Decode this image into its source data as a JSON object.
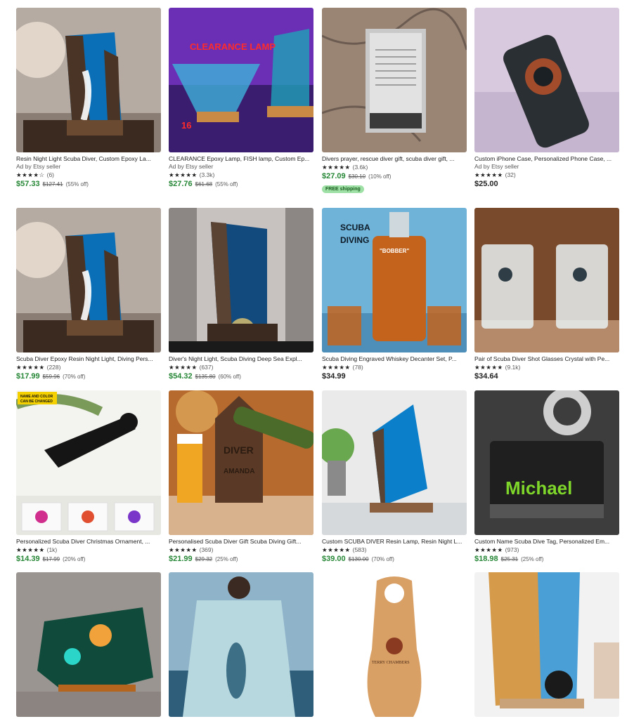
{
  "colors": {
    "sale_price": "#258635",
    "free_shipping_bg": "#9ee0a5",
    "text": "#222222",
    "muted": "#595959"
  },
  "products": [
    {
      "title": "Resin Night Light Scuba Diver, Custom Epoxy La...",
      "ad": "Ad by Etsy seller",
      "stars": "★★★★☆",
      "rating": 4,
      "reviews": "(6)",
      "price": "$57.33",
      "original": "$127.41",
      "discount": "(55% off)",
      "sale": true,
      "thumb": "resin-lamp-icon"
    },
    {
      "title": "CLEARANCE Epoxy Lamp, FISH lamp, Custom Ep...",
      "ad": "Ad by Etsy seller",
      "stars": "★★★★★",
      "rating": 5,
      "reviews": "(3.3k)",
      "price": "$27.76",
      "original": "$61.68",
      "discount": "(55% off)",
      "sale": true,
      "thumb": "clearance-lamp-icon",
      "overlay": "CLEARANCE LAMP",
      "overlay_num": "16"
    },
    {
      "title": "Divers prayer, rescue diver gift, scuba diver gift, ...",
      "ad": "",
      "stars": "★★★★★",
      "rating": 5,
      "reviews": "(3.6k)",
      "price": "$27.09",
      "original": "$30.10",
      "discount": "(10% off)",
      "sale": true,
      "badge": "FREE shipping",
      "thumb": "prayer-plaque-icon"
    },
    {
      "title": "Custom iPhone Case, Personalized Phone Case, ...",
      "ad": "Ad by Etsy seller",
      "stars": "★★★★★",
      "rating": 5,
      "reviews": "(32)",
      "price": "$25.00",
      "original": "",
      "discount": "",
      "sale": false,
      "thumb": "phone-case-icon"
    },
    {
      "title": "Scuba Diver Epoxy Resin Night Light, Diving Pers...",
      "ad": "",
      "stars": "★★★★★",
      "rating": 4.5,
      "reviews": "(228)",
      "price": "$17.99",
      "original": "$59.96",
      "discount": "(70% off)",
      "sale": true,
      "thumb": "resin-lamp-icon"
    },
    {
      "title": "Diver's Night Light, Scuba Diving Deep Sea Expl...",
      "ad": "",
      "stars": "★★★★★",
      "rating": 5,
      "reviews": "(637)",
      "price": "$54.32",
      "original": "$135.80",
      "discount": "(60% off)",
      "sale": true,
      "thumb": "night-light-icon"
    },
    {
      "title": "Scuba Diving Engraved Whiskey Decanter Set, P...",
      "ad": "",
      "stars": "★★★★★",
      "rating": 5,
      "reviews": "(78)",
      "price": "$34.99",
      "original": "",
      "discount": "",
      "sale": false,
      "thumb": "decanter-icon",
      "overlay": "SCUBA DIVING",
      "overlay_num": "\"BOBBER\""
    },
    {
      "title": "Pair of Scuba Diver Shot Glasses Crystal with Pe...",
      "ad": "",
      "stars": "★★★★★",
      "rating": 4.5,
      "reviews": "(9.1k)",
      "price": "$34.64",
      "original": "",
      "discount": "",
      "sale": false,
      "thumb": "shot-glasses-icon"
    },
    {
      "title": "Personalized Scuba Diver Christmas Ornament, ...",
      "ad": "",
      "stars": "★★★★★",
      "rating": 4.5,
      "reviews": "(1k)",
      "price": "$14.39",
      "original": "$17.99",
      "discount": "(20% off)",
      "sale": true,
      "thumb": "ornament-icon",
      "overlay": "NAME AND COLOR CAN BE CHANGED"
    },
    {
      "title": "Personalised Scuba Diver Gift Scuba Diving Gift...",
      "ad": "",
      "stars": "★★★★★",
      "rating": 5,
      "reviews": "(369)",
      "price": "$21.99",
      "original": "$29.32",
      "discount": "(25% off)",
      "sale": true,
      "thumb": "bottle-opener-icon",
      "overlay": "DIVER",
      "overlay_num": "AMANDA"
    },
    {
      "title": "Custom SCUBA DIVER Resin Lamp, Resin Night L...",
      "ad": "",
      "stars": "★★★★★",
      "rating": 5,
      "reviews": "(583)",
      "price": "$39.00",
      "original": "$130.00",
      "discount": "(70% off)",
      "sale": true,
      "thumb": "resin-lamp-blue-icon"
    },
    {
      "title": "Custom Name Scuba Dive Tag, Personalized Em...",
      "ad": "",
      "stars": "★★★★★",
      "rating": 4.5,
      "reviews": "(973)",
      "price": "$18.98",
      "original": "$25.31",
      "discount": "(25% off)",
      "sale": true,
      "thumb": "dive-tag-icon",
      "overlay": "Michael"
    },
    {
      "title": "",
      "thumb": "coral-lamp-icon"
    },
    {
      "title": "",
      "thumb": "poncho-icon"
    },
    {
      "title": "",
      "thumb": "fin-plaque-icon",
      "overlay": "TERRY CHAMBERS"
    },
    {
      "title": "",
      "thumb": "wood-lamp-icon"
    }
  ]
}
